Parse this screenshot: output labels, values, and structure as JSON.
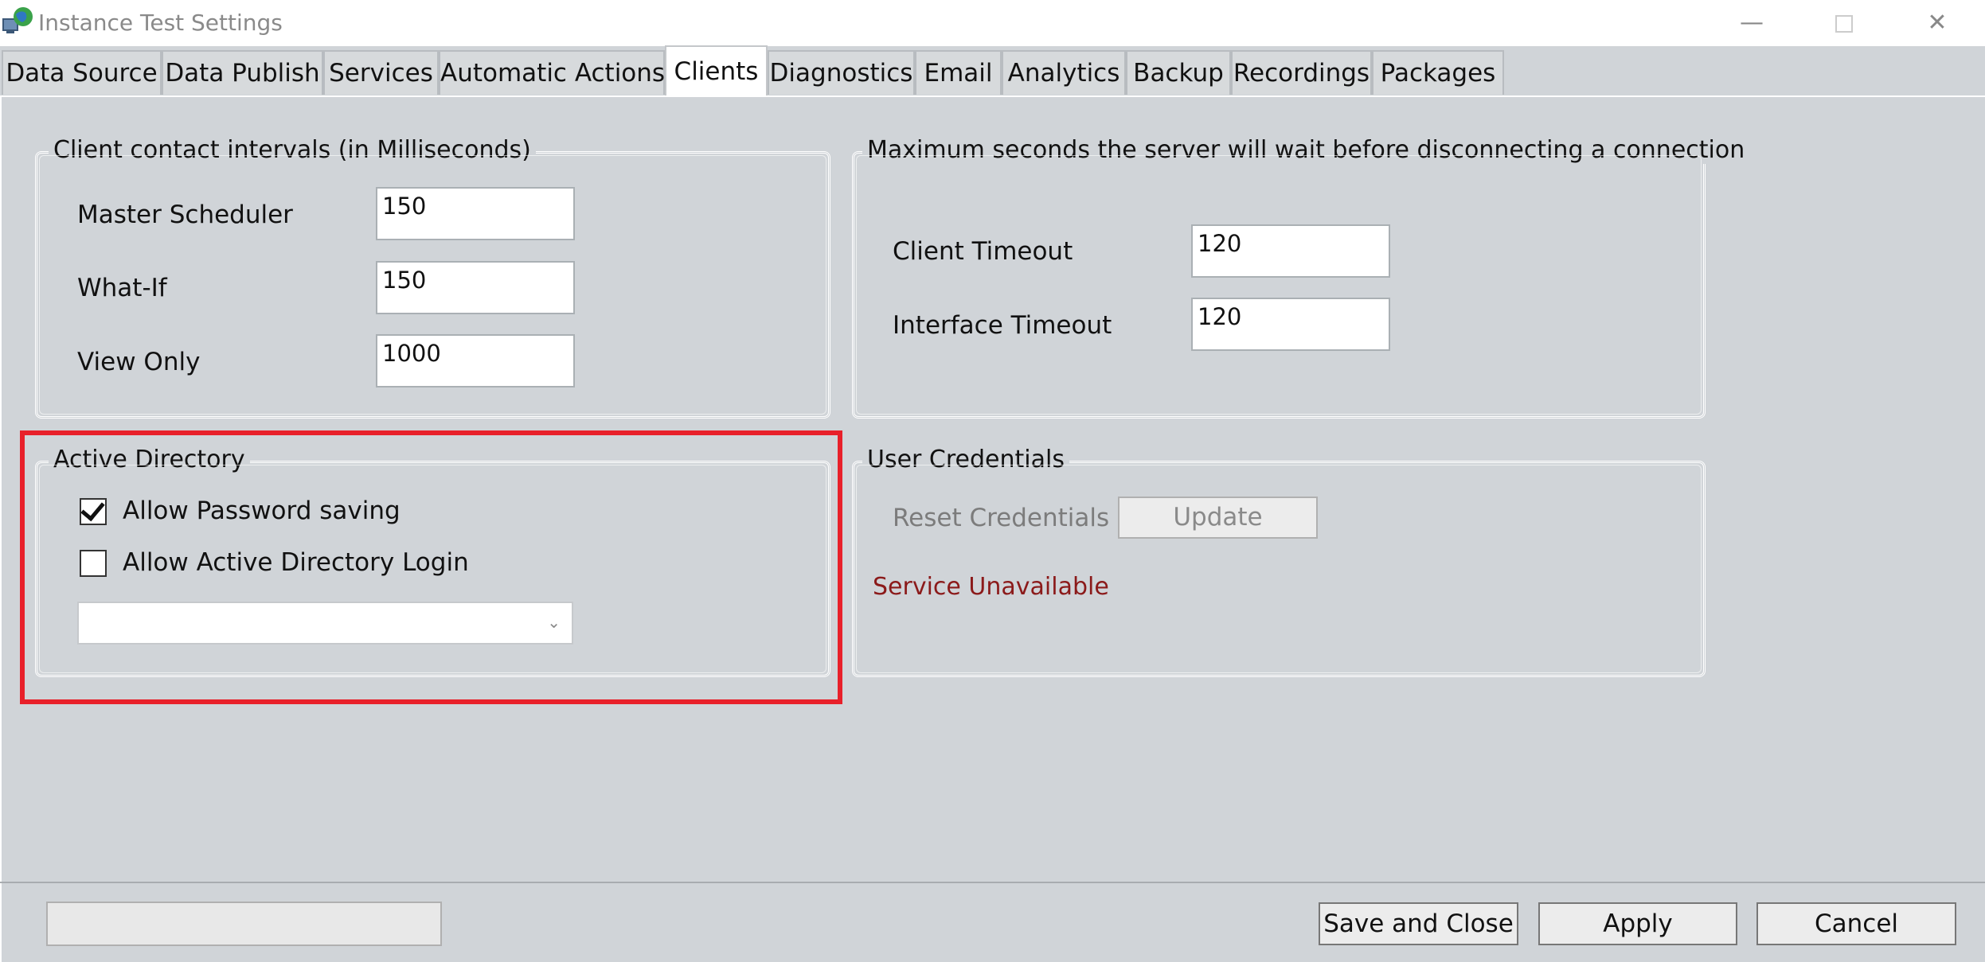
{
  "window": {
    "title": "Instance Test Settings",
    "controls": {
      "minimize": "—",
      "close": "✕"
    }
  },
  "tabs": [
    {
      "label": "Data Source",
      "active": false
    },
    {
      "label": "Data Publish",
      "active": false
    },
    {
      "label": "Services",
      "active": false
    },
    {
      "label": "Automatic Actions",
      "active": false
    },
    {
      "label": "Clients",
      "active": true
    },
    {
      "label": "Diagnostics",
      "active": false
    },
    {
      "label": "Email",
      "active": false
    },
    {
      "label": "Analytics",
      "active": false
    },
    {
      "label": "Backup",
      "active": false
    },
    {
      "label": "Recordings",
      "active": false
    },
    {
      "label": "Packages",
      "active": false
    }
  ],
  "client_intervals": {
    "legend": "Client contact intervals (in Milliseconds)",
    "master_scheduler": {
      "label": "Master Scheduler",
      "value": "150"
    },
    "what_if": {
      "label": "What-If",
      "value": "150"
    },
    "view_only": {
      "label": "View Only",
      "value": "1000"
    }
  },
  "timeouts": {
    "legend": "Maximum seconds the server will wait before disconnecting a connection",
    "client_timeout": {
      "label": "Client Timeout",
      "value": "120"
    },
    "interface_timeout": {
      "label": "Interface Timeout",
      "value": "120"
    }
  },
  "active_directory": {
    "legend": "Active Directory",
    "allow_password_saving": {
      "label": "Allow Password saving",
      "checked": true
    },
    "allow_ad_login": {
      "label": "Allow Active Directory Login",
      "checked": false
    },
    "domain_select": {
      "value": ""
    }
  },
  "user_credentials": {
    "legend": "User Credentials",
    "reset_label": "Reset Credentials",
    "update_button": "Update",
    "status": "Service Unavailable",
    "status_color": "#8b1a1a"
  },
  "footer": {
    "status_field": "",
    "save_close": "Save and Close",
    "apply": "Apply",
    "cancel": "Cancel"
  },
  "highlight_color": "#e8202a"
}
